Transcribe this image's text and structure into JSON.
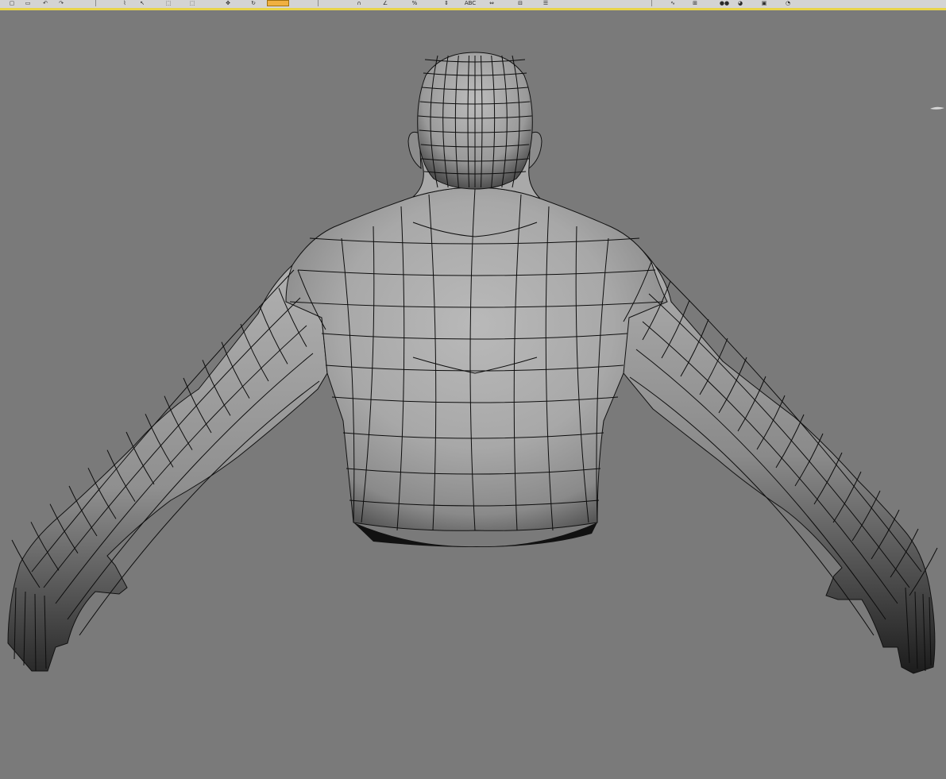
{
  "toolbar": {
    "buttons": [
      {
        "id": "new",
        "icon": "document-icon",
        "glyph": "▢"
      },
      {
        "id": "open",
        "icon": "folder-icon",
        "glyph": "▭"
      },
      {
        "id": "undo",
        "icon": "undo-icon",
        "glyph": "↶"
      },
      {
        "id": "redo",
        "icon": "redo-icon",
        "glyph": "↷"
      },
      {
        "id": "select-link",
        "icon": "link-icon",
        "glyph": "⌇"
      },
      {
        "id": "select",
        "icon": "cursor-icon",
        "glyph": "↖"
      },
      {
        "id": "select-region",
        "icon": "marquee-icon",
        "glyph": "⬚"
      },
      {
        "id": "window-crossing",
        "icon": "window-icon",
        "glyph": "⬚"
      },
      {
        "id": "move",
        "icon": "move-icon",
        "glyph": "✥"
      },
      {
        "id": "rotate",
        "icon": "rotate-icon",
        "glyph": "↻"
      },
      {
        "id": "scale",
        "icon": "scale-icon",
        "glyph": "◳"
      },
      {
        "id": "snap",
        "icon": "magnet-icon",
        "glyph": "∩"
      },
      {
        "id": "angle-snap",
        "icon": "angle-icon",
        "glyph": "∠"
      },
      {
        "id": "percent-snap",
        "icon": "percent-icon",
        "glyph": "%"
      },
      {
        "id": "spinner-snap",
        "icon": "spinner-icon",
        "glyph": "⇕"
      },
      {
        "id": "named-selection",
        "icon": "abc-icon",
        "glyph": "ABC"
      },
      {
        "id": "mirror",
        "icon": "mirror-icon",
        "glyph": "⇔"
      },
      {
        "id": "align",
        "icon": "align-icon",
        "glyph": "⊟"
      },
      {
        "id": "layers",
        "icon": "layers-icon",
        "glyph": "☰"
      },
      {
        "id": "curve-editor",
        "icon": "curve-icon",
        "glyph": "∿"
      },
      {
        "id": "schematic",
        "icon": "schematic-icon",
        "glyph": "⊞"
      },
      {
        "id": "material-editor",
        "icon": "material-icon",
        "glyph": "●●"
      },
      {
        "id": "render-setup",
        "icon": "teapot-icon",
        "glyph": "◕"
      },
      {
        "id": "rendered-frame",
        "icon": "frame-icon",
        "glyph": "▣"
      },
      {
        "id": "render",
        "icon": "render-icon",
        "glyph": "◔"
      }
    ],
    "accent": "#e8d44a",
    "active_color": "#f0b040"
  },
  "viewport": {
    "background": "#7a7a7a",
    "model": "bust-back-view",
    "shading": "smooth-highlights-edged-faces"
  },
  "gizmo": {
    "icon": "viewcube-icon"
  }
}
